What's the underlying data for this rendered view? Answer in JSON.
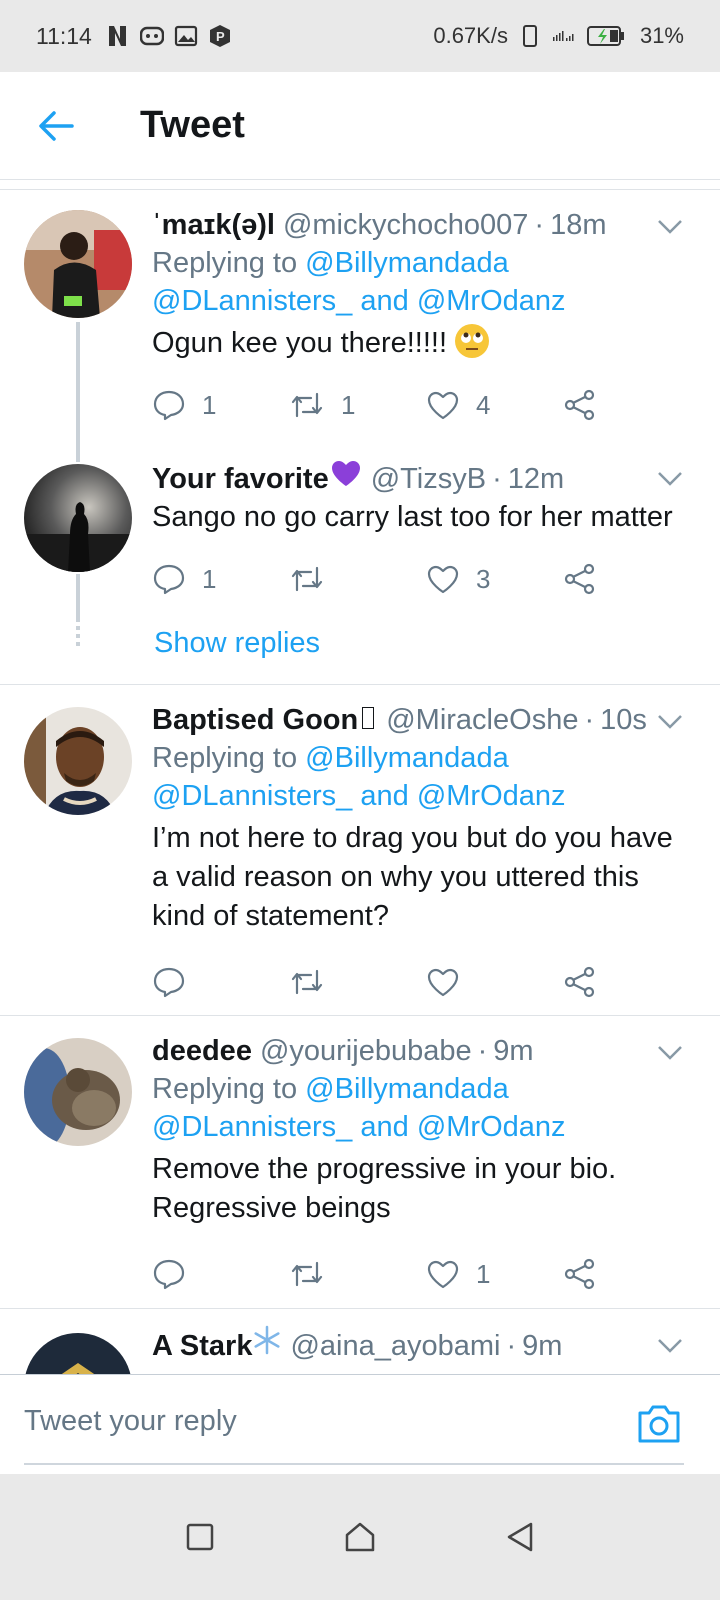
{
  "status_bar": {
    "time": "11:14",
    "speed": "0.67K/s",
    "battery": "31%",
    "icons": [
      "netflix-icon",
      "gamepad-icon",
      "gallery-icon",
      "parking-icon",
      "vibrate-icon",
      "signal-icon",
      "battery-charging-icon"
    ]
  },
  "header": {
    "title": "Tweet"
  },
  "tweets": [
    {
      "name": "ˈmaɪk(ə)l",
      "handle": "@mickychocho007",
      "time": "18m",
      "replying_label": "Replying to",
      "reply_mentions_1": "@Billymandada",
      "reply_mentions_2": "@DLannisters_",
      "and_label": "and",
      "reply_mentions_3": "@MrOdanz",
      "text": "Ogun kee you there!!!!!",
      "replies": "1",
      "retweets": "1",
      "likes": "4"
    },
    {
      "name": "Your favorite",
      "handle": "@TizsyB",
      "time": "12m",
      "text": "Sango no go carry last too for her matter",
      "replies": "1",
      "retweets": "",
      "likes": "3",
      "show_replies": "Show replies"
    },
    {
      "name": "Baptised Goon ",
      "handle": "@MiracleOshe",
      "time": "10s",
      "replying_label": "Replying to",
      "reply_mentions_1": "@Billymandada",
      "reply_mentions_2": "@DLannisters_",
      "and_label": "and",
      "reply_mentions_3": "@MrOdanz",
      "text_1": "I’m not here to drag you but do you have",
      "text_2": "a valid reason on why you uttered this",
      "text_3": "kind of statement?",
      "replies": "",
      "retweets": "",
      "likes": ""
    },
    {
      "name": "deedee",
      "handle": "@yourijebubabe",
      "time": "9m",
      "replying_label": "Replying to",
      "reply_mentions_1": "@Billymandada",
      "reply_mentions_2": "@DLannisters_",
      "and_label": "and",
      "reply_mentions_3": "@MrOdanz",
      "text_1": "Remove the progressive in your bio.",
      "text_2": "Regressive beings",
      "replies": "",
      "retweets": "",
      "likes": "1"
    },
    {
      "name": "A Stark",
      "handle": "@aina_ayobami",
      "time": "9m"
    }
  ],
  "reply_bar": {
    "placeholder": "Tweet your reply"
  },
  "colors": {
    "accent": "#1da1f2",
    "secondary_text": "#657786",
    "primary_text": "#14171a"
  }
}
